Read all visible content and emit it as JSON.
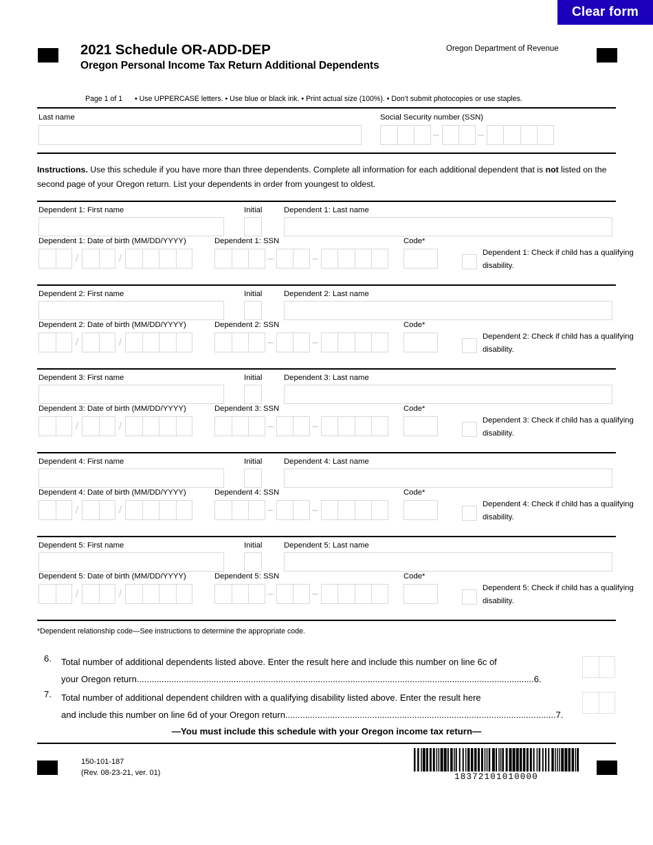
{
  "toolbar": {
    "clear_form_label": "Clear form",
    "accent_color": "#1a00bb"
  },
  "header": {
    "title_main": "2021 Schedule OR-ADD-DEP",
    "title_sub": "Oregon Personal Income Tax Return Additional Dependents",
    "department": "Oregon Department of Revenue",
    "page_of": "Page 1 of 1",
    "bullets": "• Use UPPERCASE letters.  • Use blue or black ink.  • Print actual size (100%).  • Don't submit photocopies or use staples."
  },
  "taxpayer": {
    "last_name_label": "Last name",
    "last_name_value": "",
    "ssn_label": "Social Security number (SSN)",
    "ssn_value": ""
  },
  "instructions": {
    "lead": "Instructions.",
    "body_part1": " Use this schedule if you have more than three dependents. Complete all information for each additional dependent that is ",
    "emphasis": "not",
    "body_part2": " listed on the second page of your Oregon return. List your dependents in order from youngest to oldest."
  },
  "dependents": [
    {
      "first_name_label": "Dependent 1: First name",
      "initial_label": "Initial",
      "last_name_label": "Dependent 1: Last name",
      "dob_label": "Dependent 1: Date of birth (MM/DD/YYYY)",
      "ssn_label": "Dependent 1: SSN",
      "code_label": "Code*",
      "disability_label": "Dependent 1: Check if child has a qualifying disability.",
      "first_name_value": "",
      "initial_value": "",
      "last_name_value": "",
      "dob_value": "",
      "ssn_value": "",
      "code_value": "",
      "disability_checked": false
    },
    {
      "first_name_label": "Dependent 2: First name",
      "initial_label": "Initial",
      "last_name_label": "Dependent 2: Last name",
      "dob_label": "Dependent 2: Date of birth (MM/DD/YYYY)",
      "ssn_label": "Dependent 2: SSN",
      "code_label": "Code*",
      "disability_label": "Dependent 2: Check if child has a qualifying disability.",
      "first_name_value": "",
      "initial_value": "",
      "last_name_value": "",
      "dob_value": "",
      "ssn_value": "",
      "code_value": "",
      "disability_checked": false
    },
    {
      "first_name_label": "Dependent 3: First name",
      "initial_label": "Initial",
      "last_name_label": "Dependent 3: Last name",
      "dob_label": "Dependent 3: Date of birth (MM/DD/YYYY)",
      "ssn_label": "Dependent 3: SSN",
      "code_label": "Code*",
      "disability_label": "Dependent 3: Check if child has a qualifying disability.",
      "first_name_value": "",
      "initial_value": "",
      "last_name_value": "",
      "dob_value": "",
      "ssn_value": "",
      "code_value": "",
      "disability_checked": false
    },
    {
      "first_name_label": "Dependent 4: First name",
      "initial_label": "Initial",
      "last_name_label": "Dependent 4: Last name",
      "dob_label": "Dependent 4: Date of birth (MM/DD/YYYY)",
      "ssn_label": "Dependent 4: SSN",
      "code_label": "Code*",
      "disability_label": "Dependent 4: Check if child has a qualifying disability.",
      "first_name_value": "",
      "initial_value": "",
      "last_name_value": "",
      "dob_value": "",
      "ssn_value": "",
      "code_value": "",
      "disability_checked": false
    },
    {
      "first_name_label": "Dependent 5: First name",
      "initial_label": "Initial",
      "last_name_label": "Dependent 5: Last name",
      "dob_label": "Dependent 5: Date of birth (MM/DD/YYYY)",
      "ssn_label": "Dependent 5: SSN",
      "code_label": "Code*",
      "disability_label": "Dependent 5: Check if child has a qualifying disability.",
      "first_name_value": "",
      "initial_value": "",
      "last_name_value": "",
      "dob_value": "",
      "ssn_value": "",
      "code_value": "",
      "disability_checked": false
    }
  ],
  "footnote": "*Dependent relationship code—See instructions to determine the appropriate code.",
  "lines": [
    {
      "number": "6.",
      "text_line1": "Total number of additional dependents listed above. Enter the result here and include this number on line 6c of",
      "text_line2": "your Oregon return",
      "dots": "................................................................................................................................................................",
      "end_ref": "6.",
      "value": ""
    },
    {
      "number": "7.",
      "text_line1": "Total number of additional dependent children with a qualifying disability listed above. Enter the result here",
      "text_line2": "and include this number on line 6d of your Oregon return.",
      "dots": "............................................................................................................",
      "end_ref": "7.",
      "value": ""
    }
  ],
  "must_include": "—You must include this schedule with your Oregon income tax return—",
  "footer": {
    "form_number": "150-101-187",
    "revision": "(Rev. 08-23-21, ver. 01)",
    "barcode_number": "18372101010000"
  }
}
